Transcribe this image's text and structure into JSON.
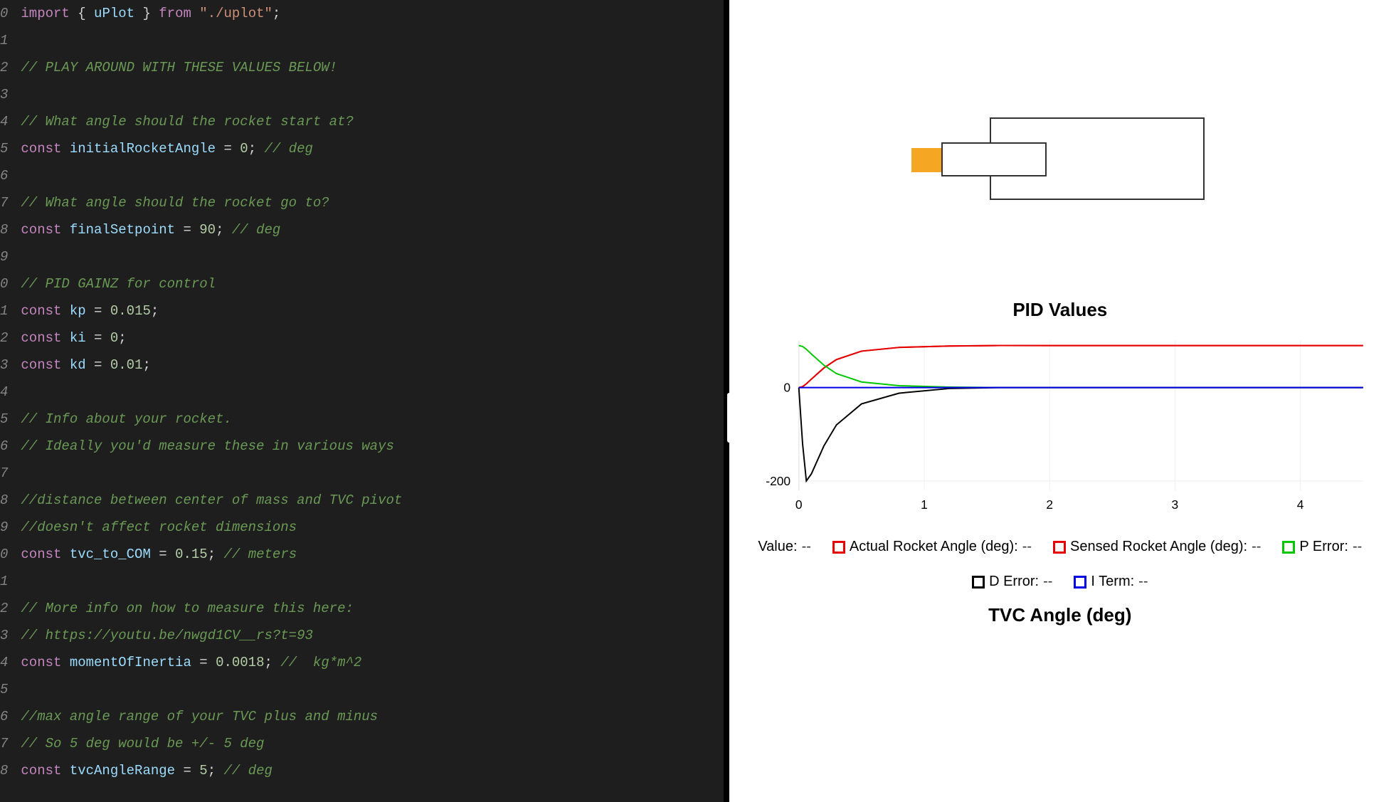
{
  "editor": {
    "lines": [
      {
        "n": "0",
        "tokens": [
          {
            "t": "import",
            "c": "kw"
          },
          {
            "t": " ",
            "c": "punc"
          },
          {
            "t": "{",
            "c": "punc"
          },
          {
            "t": " ",
            "c": "punc"
          },
          {
            "t": "uPlot",
            "c": "id"
          },
          {
            "t": " ",
            "c": "punc"
          },
          {
            "t": "}",
            "c": "punc"
          },
          {
            "t": " ",
            "c": "punc"
          },
          {
            "t": "from",
            "c": "kw"
          },
          {
            "t": " ",
            "c": "punc"
          },
          {
            "t": "\"./uplot\"",
            "c": "str"
          },
          {
            "t": ";",
            "c": "punc"
          }
        ]
      },
      {
        "n": "1",
        "tokens": []
      },
      {
        "n": "2",
        "tokens": [
          {
            "t": "// PLAY AROUND WITH THESE VALUES BELOW!",
            "c": "cm"
          }
        ]
      },
      {
        "n": "3",
        "tokens": []
      },
      {
        "n": "4",
        "tokens": [
          {
            "t": "// What angle should the rocket start at?",
            "c": "cm"
          }
        ]
      },
      {
        "n": "5",
        "tokens": [
          {
            "t": "const",
            "c": "kw"
          },
          {
            "t": " ",
            "c": "punc"
          },
          {
            "t": "initialRocketAngle",
            "c": "id"
          },
          {
            "t": " = ",
            "c": "punc"
          },
          {
            "t": "0",
            "c": "num"
          },
          {
            "t": "; ",
            "c": "punc"
          },
          {
            "t": "// deg",
            "c": "cm"
          }
        ]
      },
      {
        "n": "6",
        "tokens": []
      },
      {
        "n": "7",
        "tokens": [
          {
            "t": "// What angle should the rocket go to?",
            "c": "cm"
          }
        ]
      },
      {
        "n": "8",
        "tokens": [
          {
            "t": "const",
            "c": "kw"
          },
          {
            "t": " ",
            "c": "punc"
          },
          {
            "t": "finalSetpoint",
            "c": "id"
          },
          {
            "t": " = ",
            "c": "punc"
          },
          {
            "t": "90",
            "c": "num"
          },
          {
            "t": "; ",
            "c": "punc"
          },
          {
            "t": "// deg",
            "c": "cm"
          }
        ]
      },
      {
        "n": "9",
        "tokens": []
      },
      {
        "n": "0",
        "tokens": [
          {
            "t": "// PID GAINZ for control",
            "c": "cm"
          }
        ]
      },
      {
        "n": "1",
        "tokens": [
          {
            "t": "const",
            "c": "kw"
          },
          {
            "t": " ",
            "c": "punc"
          },
          {
            "t": "kp",
            "c": "id"
          },
          {
            "t": " = ",
            "c": "punc"
          },
          {
            "t": "0.015",
            "c": "num"
          },
          {
            "t": ";",
            "c": "punc"
          }
        ]
      },
      {
        "n": "2",
        "tokens": [
          {
            "t": "const",
            "c": "kw"
          },
          {
            "t": " ",
            "c": "punc"
          },
          {
            "t": "ki",
            "c": "id"
          },
          {
            "t": " = ",
            "c": "punc"
          },
          {
            "t": "0",
            "c": "num"
          },
          {
            "t": ";",
            "c": "punc"
          }
        ]
      },
      {
        "n": "3",
        "tokens": [
          {
            "t": "const",
            "c": "kw"
          },
          {
            "t": " ",
            "c": "punc"
          },
          {
            "t": "kd",
            "c": "id"
          },
          {
            "t": " = ",
            "c": "punc"
          },
          {
            "t": "0.01",
            "c": "num"
          },
          {
            "t": ";",
            "c": "punc"
          }
        ]
      },
      {
        "n": "4",
        "tokens": []
      },
      {
        "n": "5",
        "tokens": [
          {
            "t": "// Info about your rocket.",
            "c": "cm"
          }
        ]
      },
      {
        "n": "6",
        "tokens": [
          {
            "t": "// Ideally you'd measure these in various ways",
            "c": "cm"
          }
        ]
      },
      {
        "n": "7",
        "tokens": []
      },
      {
        "n": "8",
        "tokens": [
          {
            "t": "//distance between center of mass and TVC pivot",
            "c": "cm"
          }
        ]
      },
      {
        "n": "9",
        "tokens": [
          {
            "t": "//doesn't affect rocket dimensions",
            "c": "cm"
          }
        ]
      },
      {
        "n": "0",
        "tokens": [
          {
            "t": "const",
            "c": "kw"
          },
          {
            "t": " ",
            "c": "punc"
          },
          {
            "t": "tvc_to_COM",
            "c": "id"
          },
          {
            "t": " = ",
            "c": "punc"
          },
          {
            "t": "0.15",
            "c": "num"
          },
          {
            "t": "; ",
            "c": "punc"
          },
          {
            "t": "// meters",
            "c": "cm"
          }
        ]
      },
      {
        "n": "1",
        "tokens": []
      },
      {
        "n": "2",
        "tokens": [
          {
            "t": "// More info on how to measure this here:",
            "c": "cm"
          }
        ]
      },
      {
        "n": "3",
        "tokens": [
          {
            "t": "// https://youtu.be/nwgd1CV__rs?t=93",
            "c": "cm"
          }
        ]
      },
      {
        "n": "4",
        "tokens": [
          {
            "t": "const",
            "c": "kw"
          },
          {
            "t": " ",
            "c": "punc"
          },
          {
            "t": "momentOfInertia",
            "c": "id"
          },
          {
            "t": " = ",
            "c": "punc"
          },
          {
            "t": "0.0018",
            "c": "num"
          },
          {
            "t": "; ",
            "c": "punc"
          },
          {
            "t": "//  kg*m^2",
            "c": "cm"
          }
        ]
      },
      {
        "n": "5",
        "tokens": []
      },
      {
        "n": "6",
        "tokens": [
          {
            "t": "//max angle range of your TVC plus and minus",
            "c": "cm"
          }
        ]
      },
      {
        "n": "7",
        "tokens": [
          {
            "t": "// So 5 deg would be +/- 5 deg",
            "c": "cm"
          }
        ]
      },
      {
        "n": "8",
        "tokens": [
          {
            "t": "const",
            "c": "kw"
          },
          {
            "t": " ",
            "c": "punc"
          },
          {
            "t": "tvcAngleRange",
            "c": "id"
          },
          {
            "t": " = ",
            "c": "punc"
          },
          {
            "t": "5",
            "c": "num"
          },
          {
            "t": "; ",
            "c": "punc"
          },
          {
            "t": "// deg",
            "c": "cm"
          }
        ]
      }
    ]
  },
  "chart": {
    "title": "PID Values",
    "sub_title": "TVC Angle (deg)",
    "yticks": [
      "0",
      "-200"
    ],
    "xticks": [
      "0",
      "1",
      "2",
      "3",
      "4"
    ]
  },
  "legend": {
    "items": [
      {
        "swatch": null,
        "label": "Value:",
        "value": "--"
      },
      {
        "swatch": "#e60000",
        "label": "Actual Rocket Angle (deg):",
        "value": "--"
      },
      {
        "swatch": "#e60000",
        "label": "Sensed Rocket Angle (deg):",
        "value": "--"
      },
      {
        "swatch": "#00c800",
        "label": "P Error:",
        "value": "--"
      },
      {
        "swatch": "#000000",
        "label": "D Error:",
        "value": "--"
      },
      {
        "swatch": "#0000e6",
        "label": "I Term:",
        "value": "--"
      }
    ]
  },
  "chart_data": {
    "type": "line",
    "title": "PID Values",
    "xlabel": "",
    "ylabel": "",
    "xlim": [
      0,
      4.5
    ],
    "ylim": [
      -220,
      100
    ],
    "x": [
      0,
      0.03,
      0.06,
      0.1,
      0.15,
      0.2,
      0.3,
      0.5,
      0.8,
      1.2,
      1.6,
      2.0,
      2.5,
      3.0,
      3.5,
      4.0,
      4.5
    ],
    "series": [
      {
        "name": "Actual Rocket Angle (deg)",
        "color": "#e60000",
        "values": [
          0,
          2,
          8,
          18,
          30,
          42,
          60,
          78,
          86,
          89,
          90,
          90,
          90,
          90,
          90,
          90,
          90
        ]
      },
      {
        "name": "Sensed Rocket Angle (deg)",
        "color": "#e60000",
        "values": [
          0,
          2,
          8,
          18,
          30,
          42,
          60,
          78,
          86,
          89,
          90,
          90,
          90,
          90,
          90,
          90,
          90
        ]
      },
      {
        "name": "P Error",
        "color": "#00c800",
        "values": [
          90,
          88,
          82,
          72,
          60,
          48,
          30,
          12,
          4,
          1,
          0,
          0,
          0,
          0,
          0,
          0,
          0
        ]
      },
      {
        "name": "D Error",
        "color": "#000000",
        "values": [
          0,
          -120,
          -200,
          -185,
          -155,
          -125,
          -80,
          -35,
          -12,
          -2,
          0,
          0,
          0,
          0,
          0,
          0,
          0
        ]
      },
      {
        "name": "I Term",
        "color": "#0000e6",
        "values": [
          0,
          0,
          0,
          0,
          0,
          0,
          0,
          0,
          0,
          0,
          0,
          0,
          0,
          0,
          0,
          0,
          0
        ]
      }
    ]
  }
}
